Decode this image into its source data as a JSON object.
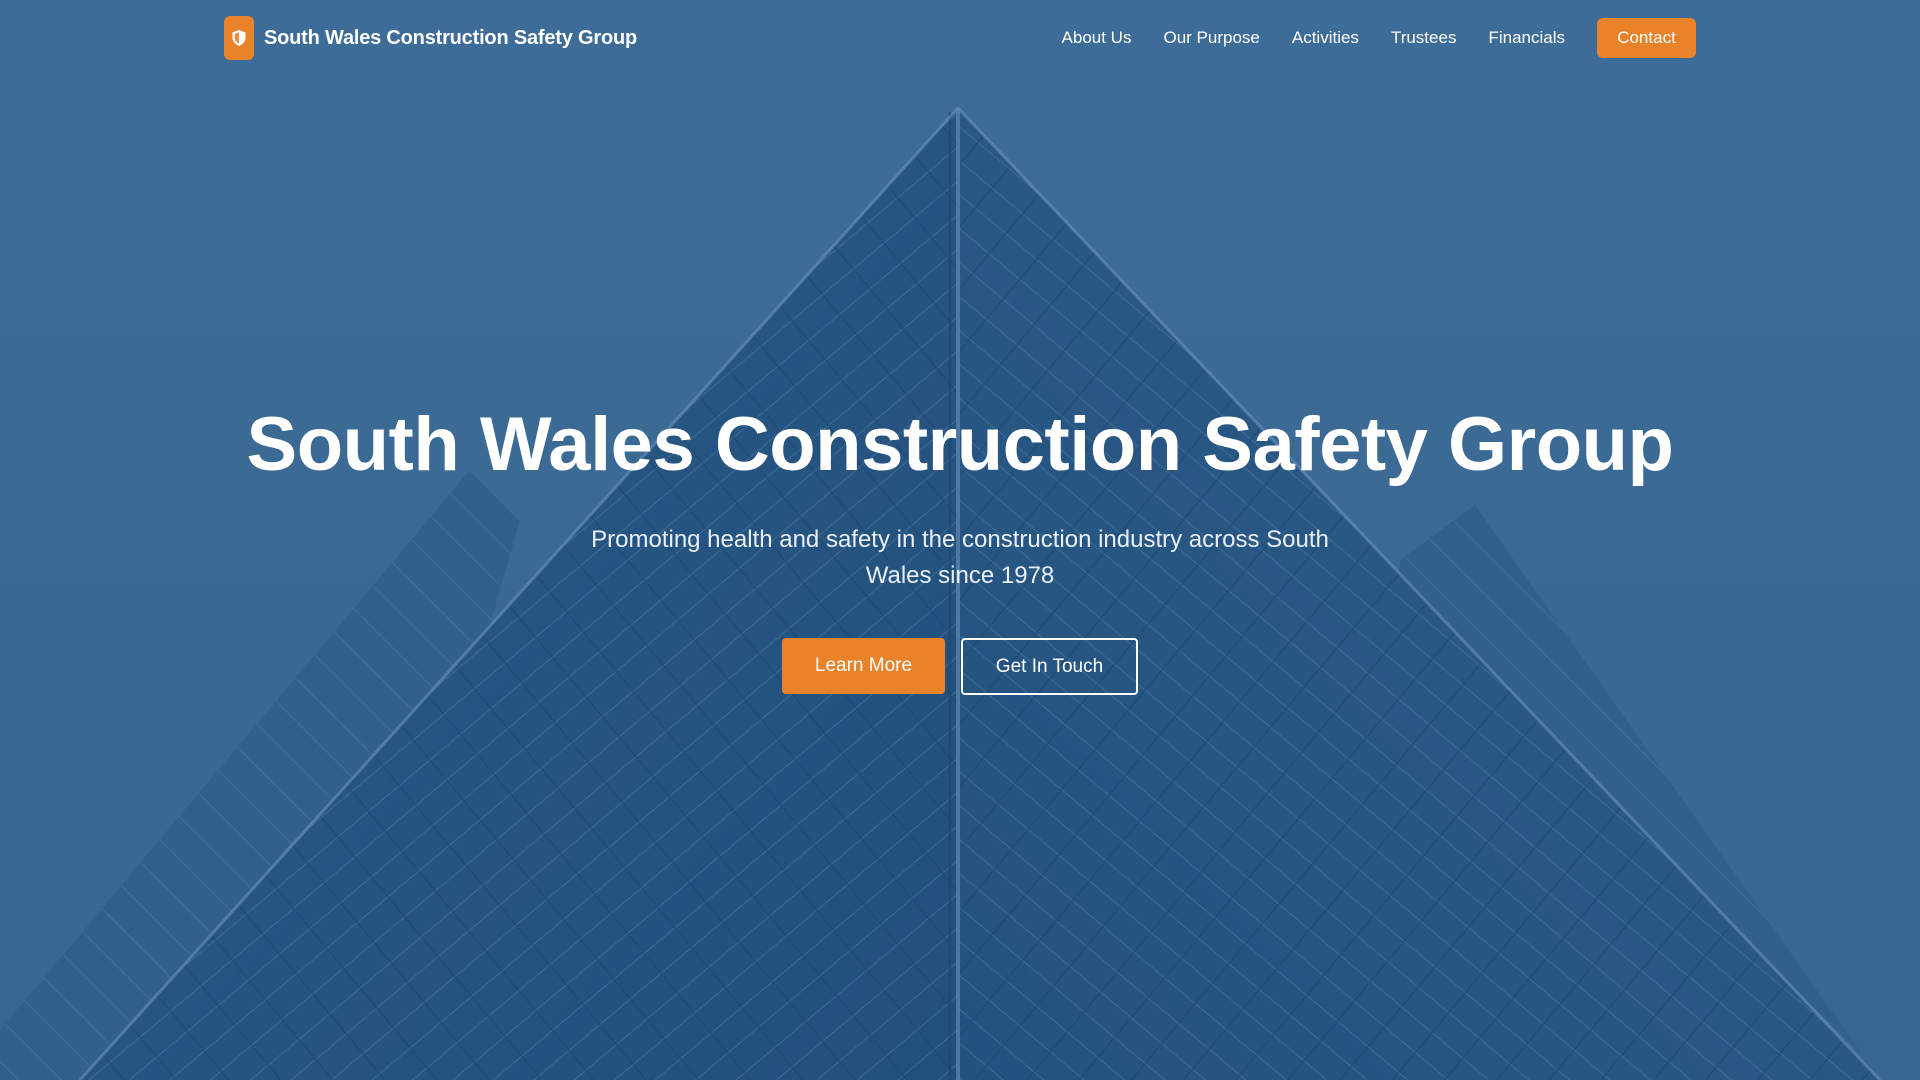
{
  "brand": {
    "name": "South Wales Construction Safety Group",
    "logo_icon": "shield-icon"
  },
  "nav": {
    "items": [
      {
        "label": "About Us"
      },
      {
        "label": "Our Purpose"
      },
      {
        "label": "Activities"
      },
      {
        "label": "Trustees"
      },
      {
        "label": "Financials"
      }
    ],
    "contact_label": "Contact"
  },
  "hero": {
    "title": "South Wales Construction Safety Group",
    "subtitle": "Promoting health and safety in the construction industry across South Wales since 1978",
    "primary_button": "Learn More",
    "secondary_button": "Get In Touch"
  },
  "colors": {
    "overlay_blue": "#3f6f99",
    "accent_orange": "#e8832a",
    "text_white": "#ffffff"
  }
}
